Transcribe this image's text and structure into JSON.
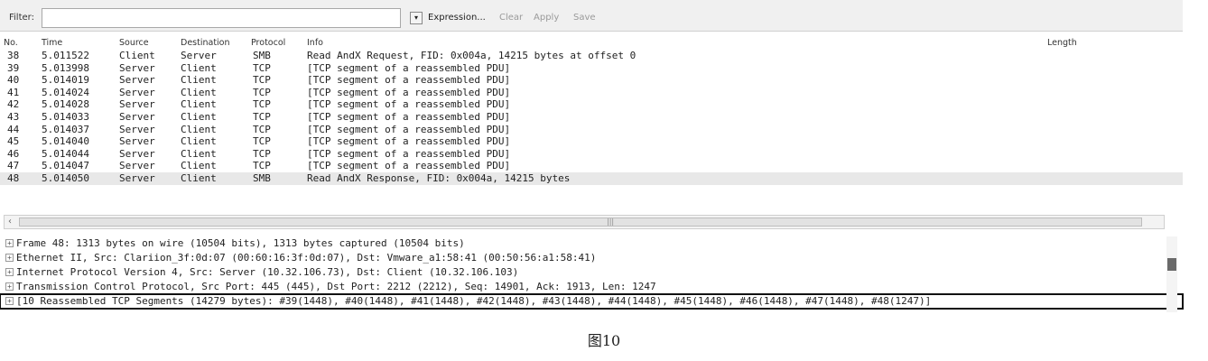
{
  "toolbar": {
    "filter_label": "Filter:",
    "filter_value": "",
    "expression_label": "Expression...",
    "clear_label": "Clear",
    "apply_label": "Apply",
    "save_label": "Save"
  },
  "packet_list": {
    "columns": [
      "No.",
      "Time",
      "Source",
      "Destination",
      "Protocol",
      "Info",
      "Length"
    ],
    "rows": [
      {
        "no": "38",
        "time": "5.011522",
        "source": "Client",
        "destination": "Server",
        "protocol": "SMB",
        "info": "Read AndX Request, FID: 0x004a, 14215 bytes at offset 0"
      },
      {
        "no": "39",
        "time": "5.013998",
        "source": "Server",
        "destination": "Client",
        "protocol": "TCP",
        "info": "[TCP segment of a reassembled PDU]"
      },
      {
        "no": "40",
        "time": "5.014019",
        "source": "Server",
        "destination": "Client",
        "protocol": "TCP",
        "info": "[TCP segment of a reassembled PDU]"
      },
      {
        "no": "41",
        "time": "5.014024",
        "source": "Server",
        "destination": "Client",
        "protocol": "TCP",
        "info": "[TCP segment of a reassembled PDU]"
      },
      {
        "no": "42",
        "time": "5.014028",
        "source": "Server",
        "destination": "Client",
        "protocol": "TCP",
        "info": "[TCP segment of a reassembled PDU]"
      },
      {
        "no": "43",
        "time": "5.014033",
        "source": "Server",
        "destination": "Client",
        "protocol": "TCP",
        "info": "[TCP segment of a reassembled PDU]"
      },
      {
        "no": "44",
        "time": "5.014037",
        "source": "Server",
        "destination": "Client",
        "protocol": "TCP",
        "info": "[TCP segment of a reassembled PDU]"
      },
      {
        "no": "45",
        "time": "5.014040",
        "source": "Server",
        "destination": "Client",
        "protocol": "TCP",
        "info": "[TCP segment of a reassembled PDU]"
      },
      {
        "no": "46",
        "time": "5.014044",
        "source": "Server",
        "destination": "Client",
        "protocol": "TCP",
        "info": "[TCP segment of a reassembled PDU]"
      },
      {
        "no": "47",
        "time": "5.014047",
        "source": "Server",
        "destination": "Client",
        "protocol": "TCP",
        "info": "[TCP segment of a reassembled PDU]"
      },
      {
        "no": "48",
        "time": "5.014050",
        "source": "Server",
        "destination": "Client",
        "protocol": "SMB",
        "info": "Read AndX Response, FID: 0x004a, 14215 bytes"
      }
    ]
  },
  "details": [
    "Frame 48: 1313 bytes on wire (10504 bits), 1313 bytes captured (10504 bits)",
    "Ethernet II, Src: Clariion_3f:0d:07 (00:60:16:3f:0d:07), Dst: Vmware_a1:58:41 (00:50:56:a1:58:41)",
    "Internet Protocol Version 4, Src: Server (10.32.106.73), Dst: Client (10.32.106.103)",
    "Transmission Control Protocol, Src Port: 445 (445), Dst Port: 2212 (2212), Seq: 14901, Ack: 1913, Len: 1247",
    "[10 Reassembled TCP Segments (14279 bytes): #39(1448), #40(1448), #41(1448), #42(1448), #43(1448), #44(1448), #45(1448), #46(1448), #47(1448), #48(1247)]"
  ],
  "caption": "图10"
}
